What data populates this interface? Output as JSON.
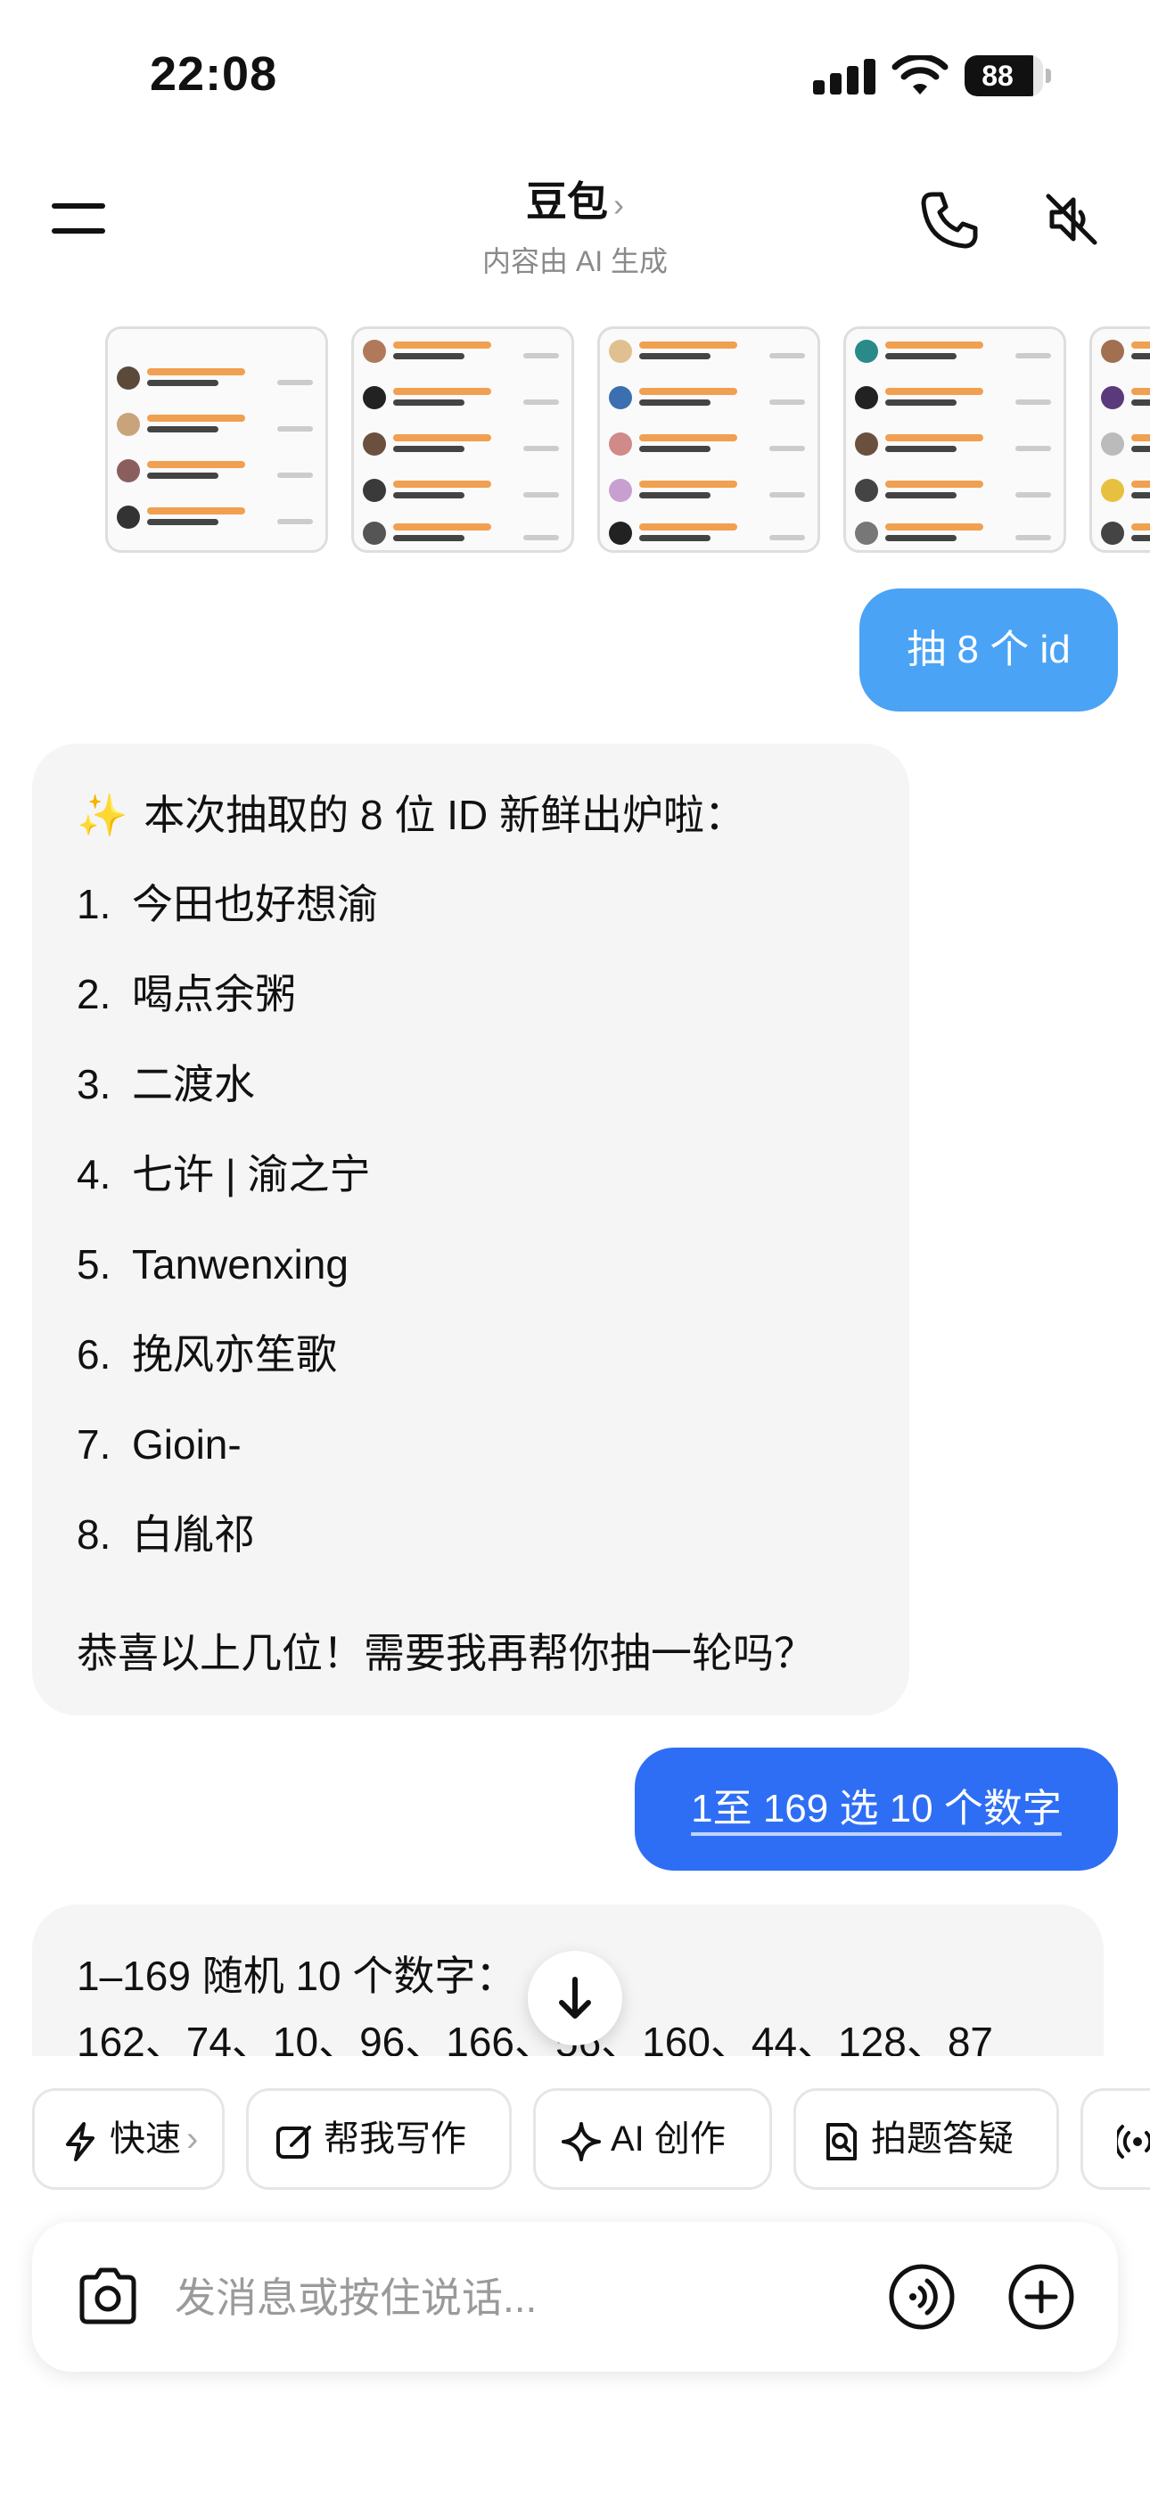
{
  "status_bar": {
    "time": "22:08",
    "battery_level": "88",
    "battery_fraction": 0.88,
    "icons": [
      "cellular-signal-icon",
      "wifi-icon",
      "battery-icon"
    ]
  },
  "header": {
    "title": "豆包",
    "title_chevron": "›",
    "subtitle": "内容由 AI 生成",
    "icons": [
      "menu-icon",
      "phone-icon",
      "speaker-mute-icon"
    ]
  },
  "image_strip": {
    "thumbnail_count": 5,
    "description_icons": [
      "screenshot-thumbnail"
    ]
  },
  "messages": [
    {
      "role": "user",
      "text": "抽 8 个 id"
    },
    {
      "role": "assistant",
      "intro_icon": "✨",
      "intro": "本次抽取的 8 位 ID 新鲜出炉啦：",
      "items": [
        {
          "num": "1.",
          "text": "今田也好想渝"
        },
        {
          "num": "2.",
          "text": "喝点余粥"
        },
        {
          "num": "3.",
          "text": "二渡水"
        },
        {
          "num": "4.",
          "text": "七许 | 渝之宁"
        },
        {
          "num": "5.",
          "text": "Tanwenxing"
        },
        {
          "num": "6.",
          "text": "挽风亦笙歌"
        },
        {
          "num": "7.",
          "text": "Gioin-"
        },
        {
          "num": "8.",
          "text": "白胤祁"
        }
      ],
      "outro": "恭喜以上几位！需要我再帮你抽一轮吗？"
    },
    {
      "role": "user",
      "text": "1至 169 选 10 个数字"
    },
    {
      "role": "assistant",
      "line1": "1–169 随机 10 个数字：",
      "line2": "162、74、10、96、166、56、160、44、128、87"
    }
  ],
  "chips": [
    {
      "label": "快速",
      "chevron": "›",
      "icon": "lightning-icon"
    },
    {
      "label": "帮我写作",
      "icon": "edit-icon"
    },
    {
      "label": "AI 创作",
      "icon": "sparkle-icon"
    },
    {
      "label": "拍题答疑",
      "icon": "document-search-icon"
    },
    {
      "label": "",
      "icon": "audio-icon"
    }
  ],
  "input": {
    "placeholder": "发消息或按住说话..."
  },
  "colors": {
    "user_bubble_light": "#4aa3f5",
    "user_bubble_dark": "#2e6ef5",
    "assistant_bubble": "#f5f5f5",
    "sparkle": "#f6b81e"
  }
}
